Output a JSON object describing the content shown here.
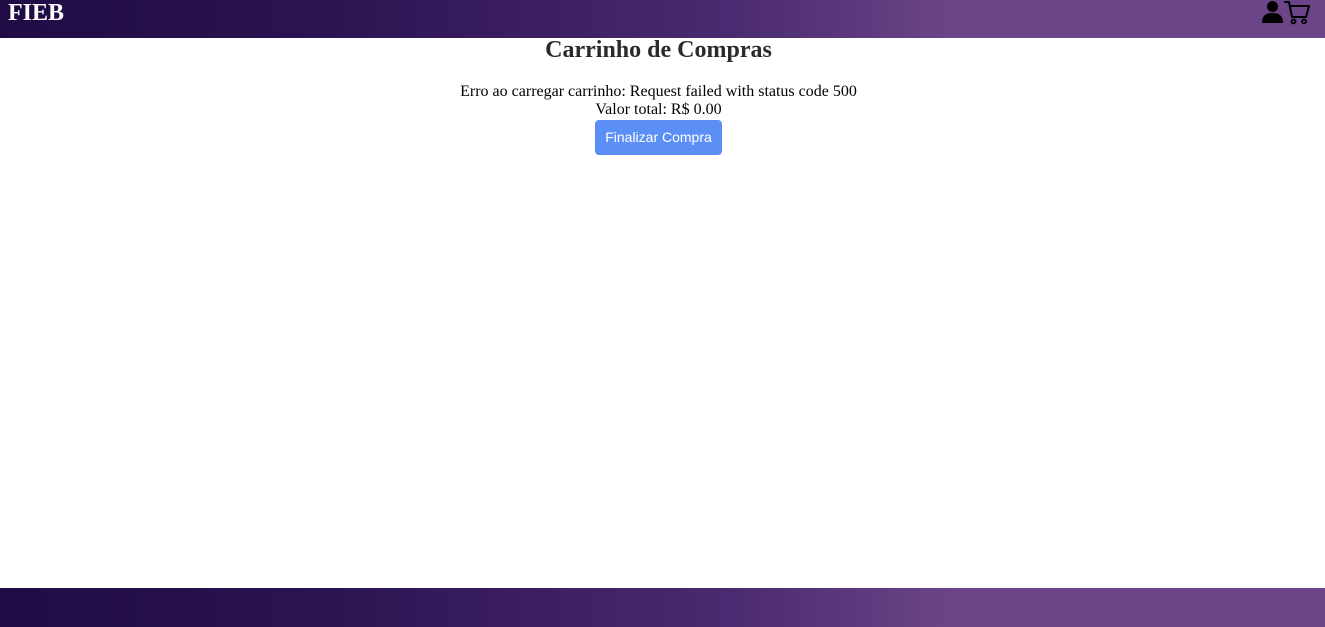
{
  "header": {
    "brand": "FIEB",
    "user_icon": "user-icon",
    "cart_icon": "shopping-cart-icon"
  },
  "main": {
    "title": "Carrinho de Compras",
    "error_message": "Erro ao carregar carrinho: Request failed with status code 500",
    "total_label": "Valor total: R$ 0.00",
    "checkout_button": "Finalizar Compra"
  },
  "colors": {
    "header_gradient_start": "#1f0c45",
    "header_gradient_end": "#6b4587",
    "button_bg": "#5b8ff5",
    "button_text": "#ffffff"
  }
}
